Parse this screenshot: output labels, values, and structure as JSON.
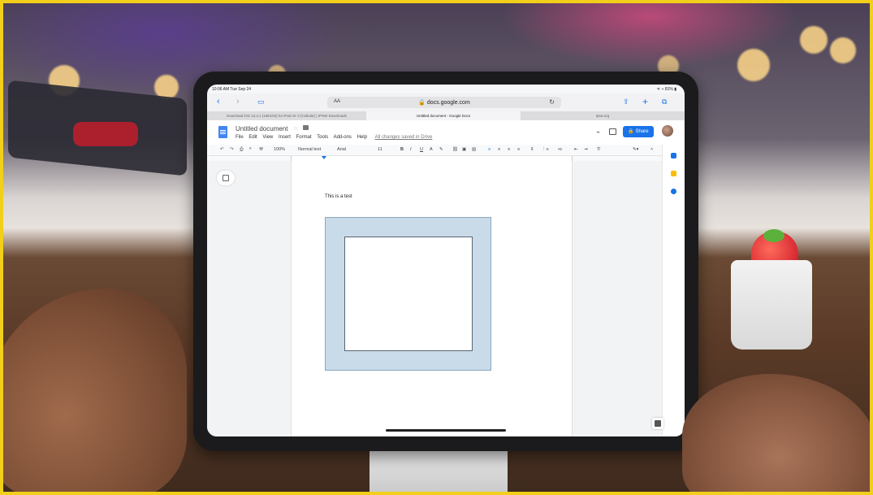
{
  "status_bar": {
    "time": "10:06 AM   Tue Sep 24",
    "right": "ᯤ ⌁ 81% ▮"
  },
  "safari": {
    "text_size_label": "AA",
    "url": "🔒 docs.google.com",
    "back_icon": "chevron-left-icon",
    "forward_icon": "chevron-right-icon"
  },
  "tabs": [
    {
      "label": "Download iOS 13.4.1 (19D102) for iPad Air 3 (Cellular) | IPSW Downloads",
      "active": false
    },
    {
      "label": "Untitled document - Google Docs",
      "active": true
    },
    {
      "label": "ipsw.org",
      "active": false
    }
  ],
  "doc": {
    "title": "Untitled document",
    "menu": [
      "File",
      "Edit",
      "View",
      "Insert",
      "Format",
      "Tools",
      "Add-ons",
      "Help"
    ],
    "saved_status": "All changes saved in Drive",
    "share_label": "🔒 Share",
    "body_text": "This is a test"
  },
  "toolbar": {
    "zoom": "100%",
    "style": "Normal text",
    "font": "Arial",
    "size": "11",
    "bold": "B",
    "italic": "I",
    "underline": "U",
    "text_color": "A"
  },
  "colors": {
    "accent": "#1a73e8",
    "drawing_fill": "#c9dbe9",
    "frame": "#f2cf1a"
  }
}
